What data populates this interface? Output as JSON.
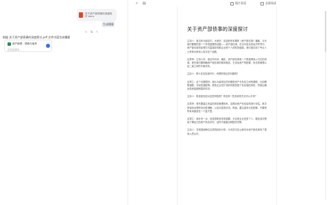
{
  "chat": {
    "file_bubble_text": "关于资产部债事的深度探讨.docx",
    "user_message": "生成播客",
    "actions": [
      "↻",
      "⧉",
      "✎",
      "⋯"
    ],
    "prompt_text": "根据 关于资产部债事的深度探讨.pdf 文件内容生成播客",
    "ref_card": {
      "title": "资产部债：债券与信托",
      "subtitle": "正在生成中…"
    }
  },
  "toolbar": {
    "collapse_icon": "«",
    "doc_icon": "▤",
    "btn1_label": "图片双语",
    "btn2_label": "全屏阅读"
  },
  "doc": {
    "title": "关于资产部债事的深度探讨",
    "paragraphs": [
      "主持人：各位听众朋友们，大家好，欢迎收听本期的《资产部债事》播客。今天我们要聊的是一个非常重要的话题——资产部债事。在当今复杂的经济环境中，资产部债事的处理方式直接影响着企业和个人的财务健康。我们邀请到了专业人士来和大家深入探讨这个话题。",
      "嘉宾甲：主持人好，各位听众好。确实，资产部债事是一个很值得深入讨论的领域。首先我们要明确资产部债事的基本概念，它涉及资产的配置、负债的管理以及二者之间的平衡关系。",
      "主持人：那么在实际操作中，有哪些常见的问题呢？",
      "嘉宾乙：这个问题很好。我认为最常见的问题是资产与负债之间的错配，比如期限错配、流动性错配等。很多企业在扩张的时候忽视了负债端的风险，导致后期出现资金链断裂的情况。",
      "主持人：那该如何应对这些风险呢？有没有一些具体的方法可以分享？",
      "嘉宾甲：首先要建立完善的风险管理体系，定期对资产负债结构进行评估。其次是保持合理的流动性储备，以应对突发情况。再者，要注重多元化配置，不要把所有鸡蛋放在一个篮子里。",
      "嘉宾乙：我补充一点，信息透明也非常重要。无论是企业还是个人，都应该清楚地了解自己的资产负债状况，这样才能做出明智的决策。",
      "主持人：非常感谢两位嘉宾的精彩分享。今天的讨论让我们对资产部债事有了更深入的认识。"
    ]
  }
}
